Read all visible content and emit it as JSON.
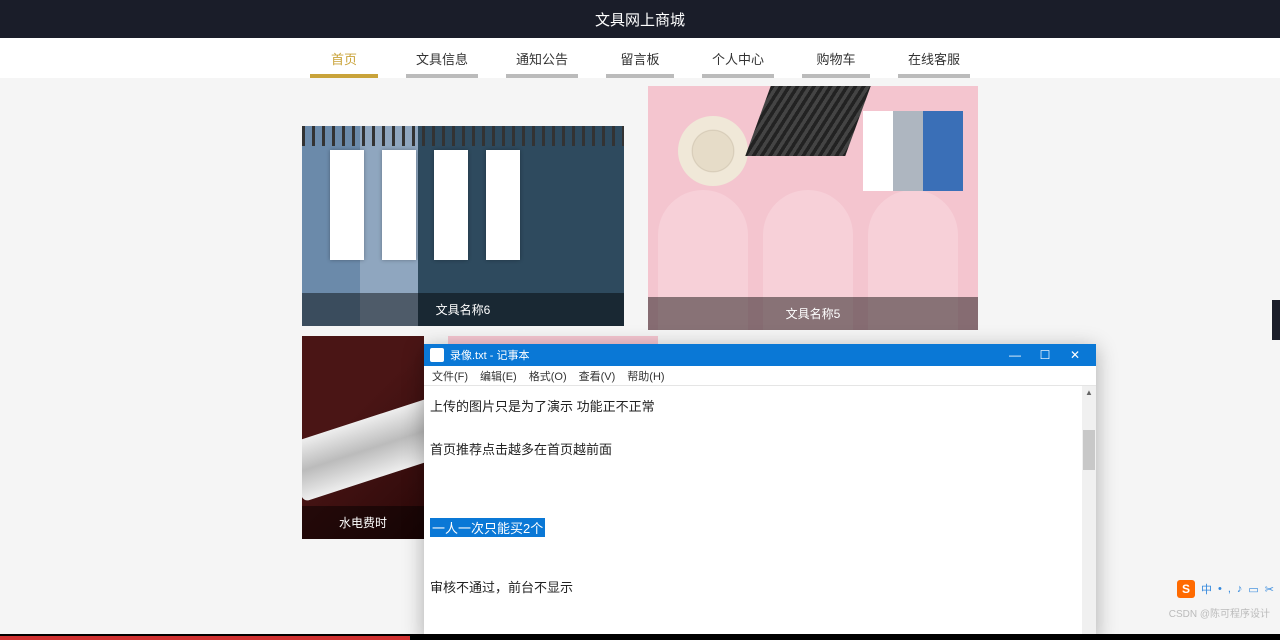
{
  "header": {
    "title": "文具网上商城"
  },
  "nav": {
    "items": [
      {
        "label": "首页",
        "active": true
      },
      {
        "label": "文具信息"
      },
      {
        "label": "通知公告"
      },
      {
        "label": "留言板"
      },
      {
        "label": "个人中心"
      },
      {
        "label": "购物车"
      },
      {
        "label": "在线客服"
      }
    ]
  },
  "cards": {
    "c1": "文具名称6",
    "c2": "文具名称5",
    "c3": "水电费时"
  },
  "notepad": {
    "title": "录像.txt - 记事本",
    "menu": {
      "file": "文件(F)",
      "edit": "编辑(E)",
      "format": "格式(O)",
      "view": "查看(V)",
      "help": "帮助(H)"
    },
    "line1": "上传的图片只是为了演示 功能正不正常",
    "line2": "首页推荐点击越多在首页越前面",
    "selected": "一人一次只能买2个",
    "line4": "审核不通过，前台不显示",
    "btn_min": "—",
    "btn_max": "☐",
    "btn_close": "✕"
  },
  "ime": {
    "logo": "S",
    "lang": "中",
    "items": [
      "•",
      ",",
      "♪",
      "▭",
      "✂"
    ]
  },
  "watermark": "CSDN @陈可程序设计"
}
